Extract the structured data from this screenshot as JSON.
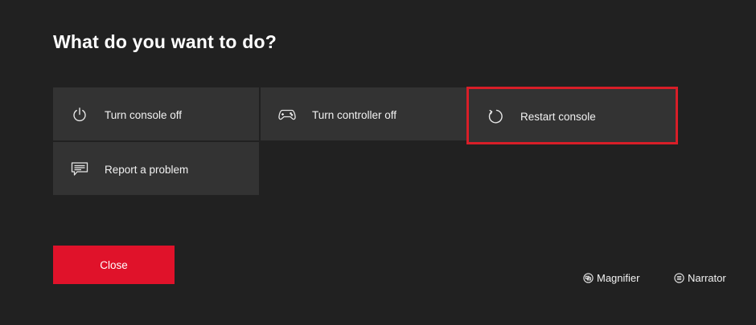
{
  "dialog": {
    "title": "What do you want to do?"
  },
  "options": [
    {
      "label": "Turn console off",
      "icon": "power-icon",
      "selected": false
    },
    {
      "label": "Turn controller off",
      "icon": "controller-icon",
      "selected": false
    },
    {
      "label": "Restart console",
      "icon": "restart-icon",
      "selected": true
    },
    {
      "label": "Report a problem",
      "icon": "feedback-icon",
      "selected": false
    }
  ],
  "actions": {
    "close_label": "Close"
  },
  "accessibility": {
    "magnifier_label": "Magnifier",
    "narrator_label": "Narrator"
  },
  "colors": {
    "background": "#212121",
    "tile": "#333333",
    "accent": "#e0122a",
    "selection_outline": "#d81e28"
  }
}
